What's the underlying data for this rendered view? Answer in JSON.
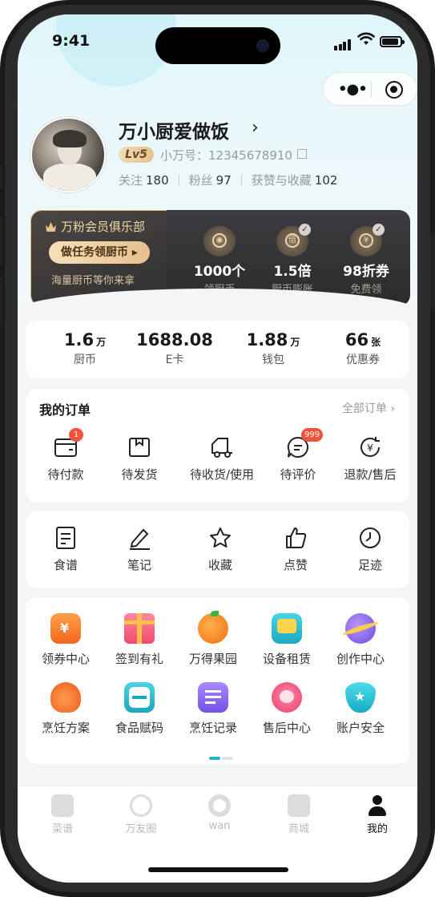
{
  "status": {
    "time": "9:41"
  },
  "profile": {
    "name": "万小厨爱做饭",
    "level": "Lv5",
    "uid_label": "小万号：12345678910",
    "follow_label": "关注",
    "follow_count": "180",
    "fans_label": "粉丝",
    "fans_count": "97",
    "likes_label": "获赞与收藏",
    "likes_count": "102"
  },
  "vip": {
    "title": "万粉会员俱乐部",
    "button": "做任务领厨币 ▸",
    "subtitle": "海量厨币等你来拿",
    "items": [
      {
        "value": "1000个",
        "label": "领厨币",
        "glyph": "◉"
      },
      {
        "value": "1.5倍",
        "label": "厨币膨胀",
        "glyph": "倍"
      },
      {
        "value": "98折券",
        "label": "免费领",
        "glyph": "¥"
      }
    ]
  },
  "wallet": [
    {
      "value": "1.6",
      "unit": "万",
      "label": "厨币"
    },
    {
      "value": "1688.08",
      "unit": "",
      "label": "E卡"
    },
    {
      "value": "1.88",
      "unit": "万",
      "label": "钱包"
    },
    {
      "value": "66",
      "unit": "张",
      "label": "优惠券"
    }
  ],
  "orders": {
    "title": "我的订单",
    "all_label": "全部订单 ›",
    "items": [
      {
        "label": "待付款",
        "badge": "1",
        "icon": "wallet-icon"
      },
      {
        "label": "待发货",
        "badge": "",
        "icon": "box-icon"
      },
      {
        "label": "待收货/使用",
        "badge": "",
        "icon": "truck-icon"
      },
      {
        "label": "待评价",
        "badge": "999",
        "icon": "comment-icon"
      },
      {
        "label": "退款/售后",
        "badge": "",
        "icon": "refund-icon"
      }
    ]
  },
  "tools": [
    {
      "label": "食谱",
      "icon": "recipe-icon"
    },
    {
      "label": "笔记",
      "icon": "pen-icon"
    },
    {
      "label": "收藏",
      "icon": "star-icon"
    },
    {
      "label": "点赞",
      "icon": "thumbs-up-icon"
    },
    {
      "label": "足迹",
      "icon": "clock-icon"
    }
  ],
  "services": [
    {
      "label": "领券中心",
      "icon": "coupon-icon",
      "color": "#f5782a"
    },
    {
      "label": "签到有礼",
      "icon": "gift-icon",
      "color": "#f45b7c"
    },
    {
      "label": "万得果园",
      "icon": "orange-icon",
      "color": "#f58a1f"
    },
    {
      "label": "设备租赁",
      "icon": "tv-icon",
      "color": "#25bcd0"
    },
    {
      "label": "创作中心",
      "icon": "planet-icon",
      "color": "#8b63e8"
    },
    {
      "label": "烹饪方案",
      "icon": "turkey-icon",
      "color": "#f56a2a"
    },
    {
      "label": "食品赋码",
      "icon": "scan-icon",
      "color": "#23b6c9"
    },
    {
      "label": "烹饪记录",
      "icon": "record-icon",
      "color": "#8a67ea"
    },
    {
      "label": "售后中心",
      "icon": "headset-icon",
      "color": "#f2557a"
    },
    {
      "label": "账户安全",
      "icon": "shield-icon",
      "color": "#25bccd"
    }
  ],
  "tabs": [
    {
      "label": "菜谱",
      "icon": "book-icon",
      "active": false
    },
    {
      "label": "万友圈",
      "icon": "swirl-icon",
      "active": false
    },
    {
      "label": "wan",
      "icon": "wan-logo-icon",
      "active": false
    },
    {
      "label": "商城",
      "icon": "bag-icon",
      "active": false
    },
    {
      "label": "我的",
      "icon": "person-icon",
      "active": true
    }
  ]
}
